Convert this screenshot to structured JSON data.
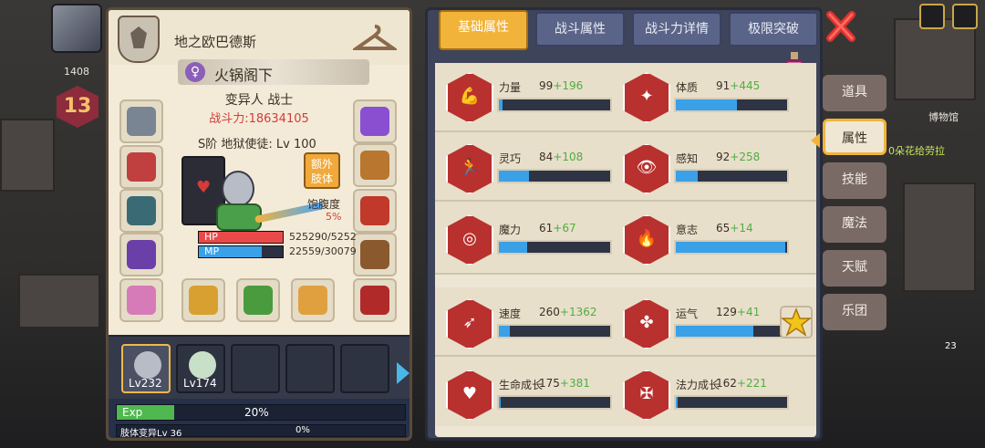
{
  "hud": {
    "level": "13",
    "gold_count": "1408",
    "hp_tag": "525290"
  },
  "character": {
    "title": "地之欧巴德斯",
    "name": "火锅阁下",
    "class": "变异人 战士",
    "power": "战斗力:18634105",
    "rank": "S阶 地狱使徒: Lv 100",
    "extra_limbs_label": "额外\n肢体",
    "satiety_label": "饱腹度",
    "satiety_value": "5%",
    "hp_label": "HP",
    "hp_value": "525290/5252",
    "hp_fill": 1.0,
    "mp_label": "MP",
    "mp_value": "22559/30079",
    "mp_fill": 0.75
  },
  "pets": [
    {
      "level": "Lv232",
      "active": true
    },
    {
      "level": "Lv174",
      "active": false
    },
    {
      "level": "",
      "active": false
    },
    {
      "level": "",
      "active": false
    },
    {
      "level": "",
      "active": false
    }
  ],
  "exp": {
    "label": "Exp",
    "percent": "20%",
    "fill": 0.2,
    "mutation_label": "肢体变异Lv 36",
    "mutation_percent": "0%"
  },
  "tabs": [
    "基础属性",
    "战斗属性",
    "战斗力详情",
    "极限突破"
  ],
  "active_tab": 0,
  "stats": [
    {
      "name": "力量",
      "base": "99",
      "bonus": "+196",
      "fill": 0.03,
      "icon": "muscle-icon"
    },
    {
      "name": "体质",
      "base": "91",
      "bonus": "+445",
      "fill": 0.55,
      "icon": "body-icon"
    },
    {
      "name": "灵巧",
      "base": "84",
      "bonus": "+108",
      "fill": 0.27,
      "icon": "running-icon"
    },
    {
      "name": "感知",
      "base": "92",
      "bonus": "+258",
      "fill": 0.2,
      "icon": "eye-icon"
    },
    {
      "name": "魔力",
      "base": "61",
      "bonus": "+67",
      "fill": 0.25,
      "icon": "swirl-icon"
    },
    {
      "name": "意志",
      "base": "65",
      "bonus": "+14",
      "fill": 0.98,
      "icon": "flame-head-icon"
    },
    {
      "name": "速度",
      "base": "260",
      "bonus": "+1362",
      "fill": 0.1,
      "icon": "wing-icon"
    },
    {
      "name": "运气",
      "base": "129",
      "bonus": "+41",
      "fill": 0.7,
      "icon": "clover-icon"
    },
    {
      "name": "生命成长",
      "base": "175",
      "bonus": "+381",
      "fill": 0.02,
      "icon": "heart-icon"
    },
    {
      "name": "法力成长",
      "base": "162",
      "bonus": "+221",
      "fill": 0.02,
      "icon": "staff-icon"
    }
  ],
  "side_menu": [
    "道具",
    "属性",
    "技能",
    "魔法",
    "天赋",
    "乐团"
  ],
  "active_side": 1,
  "world": {
    "museum": "博物馆",
    "quest": "0朵花给劳拉",
    "corner_count": "23"
  },
  "colors": {
    "accent": "#f2b33a",
    "bonus": "#4fae3f",
    "power": "#d43b3b",
    "bar": "#3aa0e8",
    "stat_icon": "#b8312e"
  }
}
